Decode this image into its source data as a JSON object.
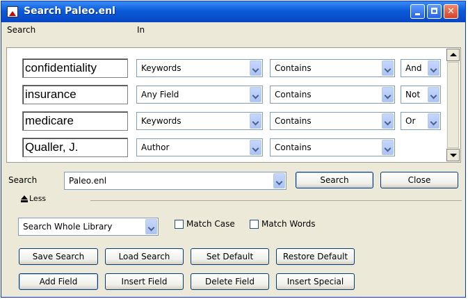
{
  "window": {
    "title": "Search Paleo.enl",
    "min": "",
    "max": "",
    "close": "✕"
  },
  "headers": {
    "search": "Search",
    "in": "In"
  },
  "rows": [
    {
      "term": "confidentiality",
      "field": "Keywords",
      "op": "Contains",
      "bool": "And"
    },
    {
      "term": "insurance",
      "field": "Any Field",
      "op": "Contains",
      "bool": "Not"
    },
    {
      "term": "medicare",
      "field": "Keywords",
      "op": "Contains",
      "bool": "Or"
    },
    {
      "term": "Qualler, J.",
      "field": "Author",
      "op": "Contains",
      "bool": ""
    }
  ],
  "search_bar": {
    "label": "Search",
    "library": "Paleo.enl",
    "search_button": "Search",
    "close_button": "Close"
  },
  "less": {
    "label": "Less",
    "icon": "up-triangle-icon"
  },
  "options": {
    "scope": "Search Whole Library",
    "match_case": "Match Case",
    "match_words": "Match Words"
  },
  "buttons": {
    "row1": [
      "Save Search",
      "Load Search",
      "Set Default",
      "Restore Default"
    ],
    "row2": [
      "Add Field",
      "Insert Field",
      "Delete Field",
      "Insert Special"
    ]
  }
}
